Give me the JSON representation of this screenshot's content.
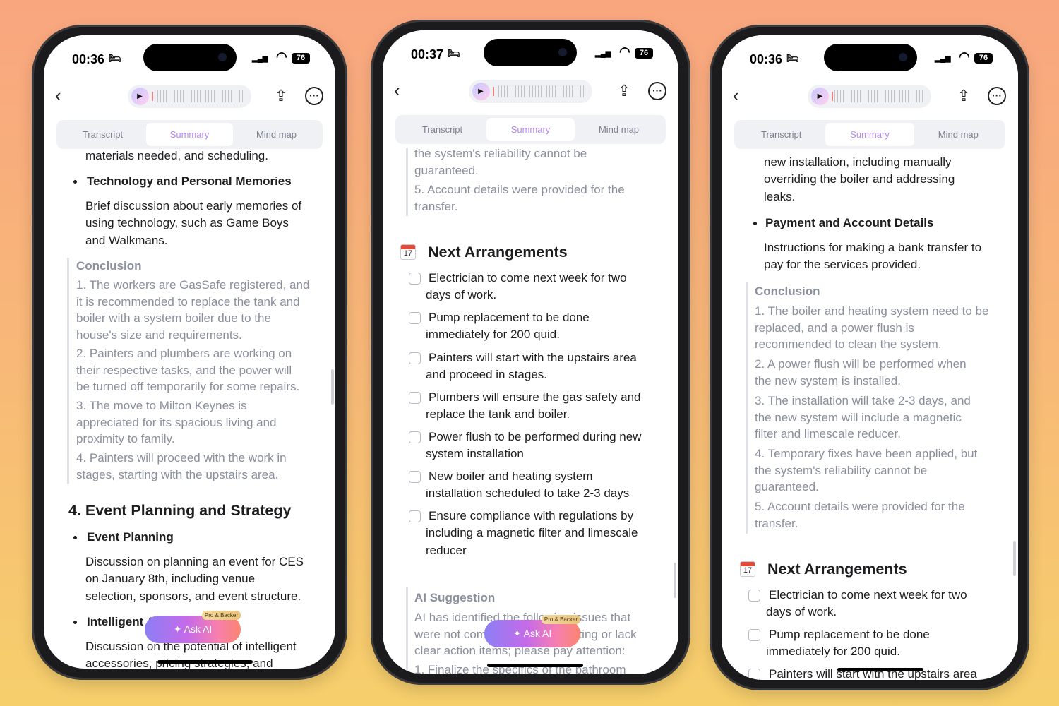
{
  "colors": {
    "accent": "#b48af0",
    "background_top": "#f9a67f",
    "background_bottom": "#f6cf6b"
  },
  "phones": [
    {
      "time": "00:36",
      "status_icon": "bed-icon",
      "battery": "76",
      "tabs": [
        "Transcript",
        "Summary",
        "Mind map"
      ],
      "active_tab": 1,
      "ask_ai": {
        "label": "Ask AI",
        "badge": "Pro & Backer"
      },
      "content": [
        {
          "kind": "text",
          "lines": [
            "materials needed, and scheduling."
          ]
        },
        {
          "kind": "bullet",
          "lines": [
            "Technology and Personal Memories"
          ]
        },
        {
          "kind": "text",
          "lines": [
            "Brief discussion about early memories of",
            "using technology, such as Game Boys",
            "and Walkmans."
          ]
        },
        {
          "kind": "qhead",
          "lines": [
            "Conclusion"
          ]
        },
        {
          "kind": "quote",
          "lines": [
            "1. The workers are GasSafe registered, and",
            "it is recommended to replace the tank and",
            "boiler with a system boiler due to the",
            "house's size and requirements."
          ]
        },
        {
          "kind": "quote",
          "lines": [
            "2. Painters and plumbers are working on",
            "their respective tasks, and the power will",
            "be turned off temporarily for some repairs."
          ]
        },
        {
          "kind": "quote",
          "lines": [
            "3. The move to Milton Keynes is",
            "appreciated for its spacious living and",
            "proximity to family."
          ]
        },
        {
          "kind": "quote",
          "lines": [
            "4. Painters will proceed with the work in",
            "stages, starting with the upstairs area."
          ]
        },
        {
          "kind": "section",
          "lines": [
            "4. Event Planning and Strategy"
          ]
        },
        {
          "kind": "bullet",
          "lines": [
            "Event Planning"
          ]
        },
        {
          "kind": "text",
          "lines": [
            "Discussion on planning an event for CES",
            "on January 8th, including venue",
            "selection, sponsors, and event structure."
          ]
        },
        {
          "kind": "bullet",
          "lines": [
            "Intelligent Accessories"
          ]
        },
        {
          "kind": "text",
          "lines": [
            "Discussion on the potential of intelligent",
            "accessories, pricing strategies, and"
          ]
        }
      ]
    },
    {
      "time": "00:37",
      "status_icon": "bed-icon",
      "battery": "76",
      "tabs": [
        "Transcript",
        "Summary",
        "Mind map"
      ],
      "active_tab": 1,
      "ask_ai": {
        "label": "Ask AI",
        "badge": "Pro & Backer"
      },
      "content": [
        {
          "kind": "quote",
          "lines": [
            "the system's reliability cannot be",
            "guaranteed."
          ]
        },
        {
          "kind": "quote",
          "lines": [
            "5. Account details were provided for the",
            "transfer."
          ]
        },
        {
          "kind": "section",
          "icon": "calendar-icon",
          "icon_text": "17",
          "lines": [
            "Next Arrangements"
          ]
        },
        {
          "kind": "check",
          "checked": false,
          "lines": [
            "Electrician to come next week for two",
            "days of work."
          ]
        },
        {
          "kind": "check",
          "checked": false,
          "lines": [
            "Pump replacement to be done",
            "immediately for 200 quid."
          ]
        },
        {
          "kind": "check",
          "checked": false,
          "lines": [
            "Painters will start with the upstairs area",
            "and proceed in stages."
          ]
        },
        {
          "kind": "check",
          "checked": false,
          "lines": [
            "Plumbers will ensure the gas safety and",
            "replace the tank and boiler."
          ]
        },
        {
          "kind": "check",
          "checked": false,
          "lines": [
            "Power flush to be performed during new",
            "system installation"
          ]
        },
        {
          "kind": "check",
          "checked": false,
          "lines": [
            "New boiler and heating system",
            "installation scheduled to take 2-3 days"
          ]
        },
        {
          "kind": "check",
          "checked": false,
          "lines": [
            "Ensure compliance with regulations by",
            "including a magnetic filter and limescale",
            "reducer"
          ]
        },
        {
          "kind": "qhead",
          "lines": [
            "AI Suggestion"
          ]
        },
        {
          "kind": "quote",
          "lines": [
            "AI has identified the following issues that",
            "were not completed in the meeting or lack",
            "clear action items; please pay attention:"
          ]
        },
        {
          "kind": "quote",
          "lines": [
            "1. Finalize the specifics of the bathroom"
          ]
        }
      ]
    },
    {
      "time": "00:36",
      "status_icon": "bed-icon",
      "battery": "76",
      "tabs": [
        "Transcript",
        "Summary",
        "Mind map"
      ],
      "active_tab": 1,
      "content": [
        {
          "kind": "text",
          "lines": [
            "new installation, including manually",
            "overriding the boiler and addressing",
            "leaks."
          ]
        },
        {
          "kind": "bullet",
          "lines": [
            "Payment and Account Details"
          ]
        },
        {
          "kind": "text",
          "lines": [
            "Instructions for making a bank transfer to",
            "pay for the services provided."
          ]
        },
        {
          "kind": "qhead",
          "lines": [
            "Conclusion"
          ]
        },
        {
          "kind": "quote",
          "lines": [
            "1. The boiler and heating system need to be",
            "replaced, and a power flush is",
            "recommended to clean the system."
          ]
        },
        {
          "kind": "quote",
          "lines": [
            "2. A power flush will be performed when",
            "the new system is installed."
          ]
        },
        {
          "kind": "quote",
          "lines": [
            "3. The installation will take 2-3 days, and",
            "the new system will include a magnetic",
            "filter and limescale reducer."
          ]
        },
        {
          "kind": "quote",
          "lines": [
            "4. Temporary fixes have been applied, but",
            "the system's reliability cannot be",
            "guaranteed."
          ]
        },
        {
          "kind": "quote",
          "lines": [
            "5. Account details were provided for the",
            "transfer."
          ]
        },
        {
          "kind": "section",
          "icon": "calendar-icon",
          "icon_text": "17",
          "lines": [
            "Next Arrangements"
          ]
        },
        {
          "kind": "check",
          "checked": false,
          "lines": [
            "Electrician to come next week for two",
            "days of work."
          ]
        },
        {
          "kind": "check",
          "checked": false,
          "lines": [
            "Pump replacement to be done",
            "immediately for 200 quid."
          ]
        },
        {
          "kind": "check",
          "checked": false,
          "lines": [
            "Painters will start with the upstairs area"
          ]
        }
      ]
    }
  ]
}
